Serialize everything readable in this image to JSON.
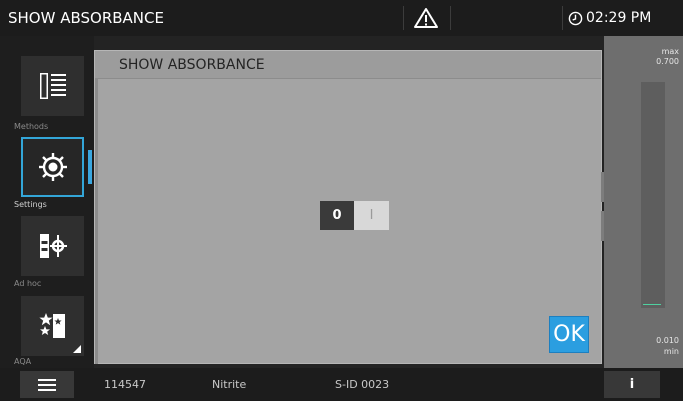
{
  "header": {
    "title": "SHOW ABSORBANCE",
    "warning_icon": "warning-triangle-icon",
    "time": "02:29 PM",
    "clock_icon": "clock-icon"
  },
  "sidebar": {
    "items": [
      {
        "label": "Methods",
        "icon": "methods-list-icon",
        "active": false
      },
      {
        "label": "Settings",
        "icon": "gear-icon",
        "active": true
      },
      {
        "label": "Ad hoc",
        "icon": "ad-hoc-measure-icon",
        "active": false
      },
      {
        "label": "AQA",
        "icon": "aqa-stars-icon",
        "active": false
      }
    ]
  },
  "dialog": {
    "title": "SHOW ABSORBANCE",
    "toggle": {
      "off_label": "0",
      "on_label": "I",
      "state": "off"
    },
    "ok_label": "OK"
  },
  "scale": {
    "max_label": "max",
    "max_value": "0.700",
    "min_value": "0.010",
    "min_label": "min"
  },
  "footer": {
    "menu_icon": "hamburger-menu-icon",
    "sample_number": "114547",
    "method": "Nitrite",
    "sample_id": "S-ID 0023",
    "info_label": "i"
  },
  "colors": {
    "accent": "#2b9ee0",
    "dialog_bg": "#a4a4a4",
    "header_bg": "#1c1c1c"
  }
}
